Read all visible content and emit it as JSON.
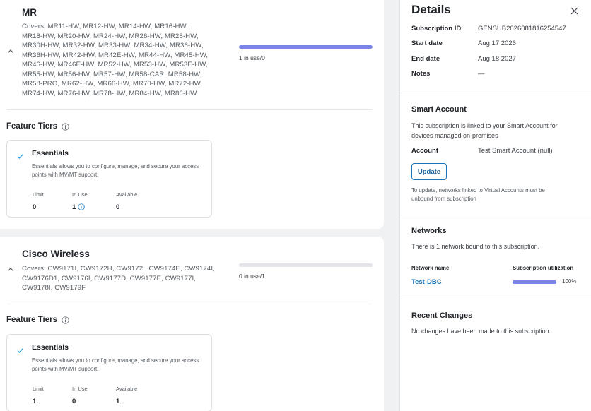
{
  "products": [
    {
      "title": "MR",
      "covers_lines": [
        "Covers: MR11-HW, MR12-HW, MR14-HW, MR16-HW,",
        "MR18-HW, MR20-HW, MR24-HW, MR26-HW, MR28-HW,",
        "MR30H-HW, MR32-HW, MR33-HW, MR34-HW, MR36-HW,",
        "MR36H-HW, MR42-HW, MR42E-HW, MR44-HW, MR45-HW,",
        "MR46-HW, MR46E-HW, MR52-HW, MR53-HW, MR53E-HW,",
        "MR55-HW, MR56-HW, MR57-HW, MR58-CAR, MR58-HW,",
        "MR58-PRO, MR62-HW, MR66-HW, MR70-HW, MR72-HW,",
        "MR74-HW, MR76-HW, MR78-HW, MR84-HW, MR86-HW"
      ],
      "usage_text": "1 in use/0",
      "usage_fraction": 1.0,
      "feature_tiers_label": "Feature Tiers",
      "tier": {
        "name": "Essentials",
        "description": "Essentials allows you to configure, manage, and secure your access points with MV/MT support.",
        "limit_label": "Limit",
        "limit_value": "0",
        "in_use_label": "In Use",
        "in_use_value": "1",
        "available_label": "Available",
        "available_value": "0"
      }
    },
    {
      "title": "Cisco Wireless",
      "covers_lines": [
        "Covers: CW9171I, CW9172H, CW9172I, CW9174E, CW9174I,",
        "CW9176D1, CW9176I, CW9177D, CW9177E, CW9177I,",
        "CW9178I, CW9179F"
      ],
      "usage_text": "0 in use/1",
      "usage_fraction": 0.0,
      "feature_tiers_label": "Feature Tiers",
      "tier": {
        "name": "Essentials",
        "description": "Essentials allows you to configure, manage, and secure your access points with MV/MT support.",
        "limit_label": "Limit",
        "limit_value": "1",
        "in_use_label": "In Use",
        "in_use_value": "0",
        "available_label": "Available",
        "available_value": "1"
      }
    }
  ],
  "details": {
    "title": "Details",
    "subscription_id_label": "Subscription ID",
    "subscription_id": "GENSUB2026081816254547",
    "start_date_label": "Start date",
    "start_date": "Aug 17 2026",
    "end_date_label": "End date",
    "end_date": "Aug 18 2027",
    "notes_label": "Notes",
    "notes": "—"
  },
  "smart_account": {
    "title": "Smart Account",
    "description_lines": [
      "This subscription is linked to your Smart Account for",
      "devices managed on-premises"
    ],
    "account_label": "Account",
    "account_value": "Test Smart Account (null)",
    "update_label": "Update",
    "note_lines": [
      "To update, networks linked to Virtual Accounts must be",
      "unbound from subscription"
    ]
  },
  "networks": {
    "title": "Networks",
    "summary": "There is 1 network bound to this subscription.",
    "col_name": "Network name",
    "col_util": "Subscription utilization",
    "rows": [
      {
        "name": "Test-DBC",
        "utilization_text": "100%",
        "utilization_fraction": 1.0
      }
    ]
  },
  "recent_changes": {
    "title": "Recent Changes",
    "text": "No changes have been made to this subscription."
  },
  "colors": {
    "accent_bar": "#7b85e8",
    "link": "#1a73b8",
    "check": "#2e9bd6"
  }
}
